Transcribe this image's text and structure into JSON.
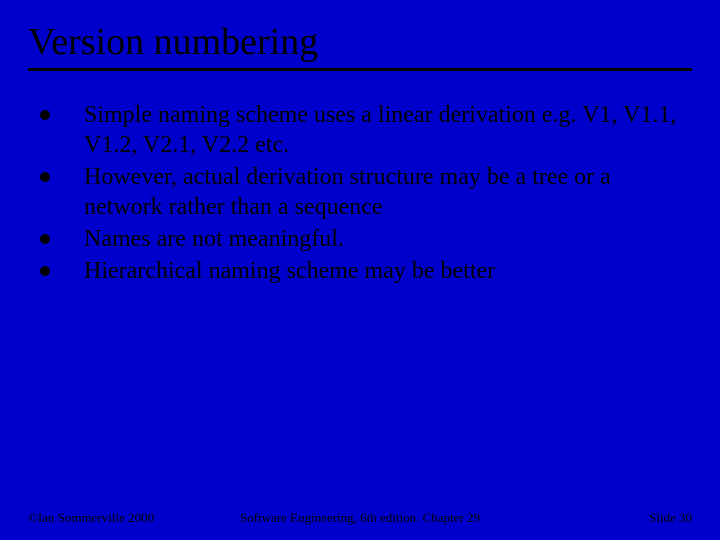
{
  "title": "Version numbering",
  "bullets": [
    "Simple naming scheme uses a linear derivation e.g. V1, V1.1, V1.2, V2.1, V2.2 etc.",
    "However, actual derivation structure may be a tree or a network rather than a sequence",
    "Names are not meaningful.",
    "Hierarchical naming scheme may be better"
  ],
  "footer": {
    "left": "©Ian Sommerville 2000",
    "center": "Software Engineering, 6th edition. Chapter 29",
    "right": "Slide 30"
  }
}
